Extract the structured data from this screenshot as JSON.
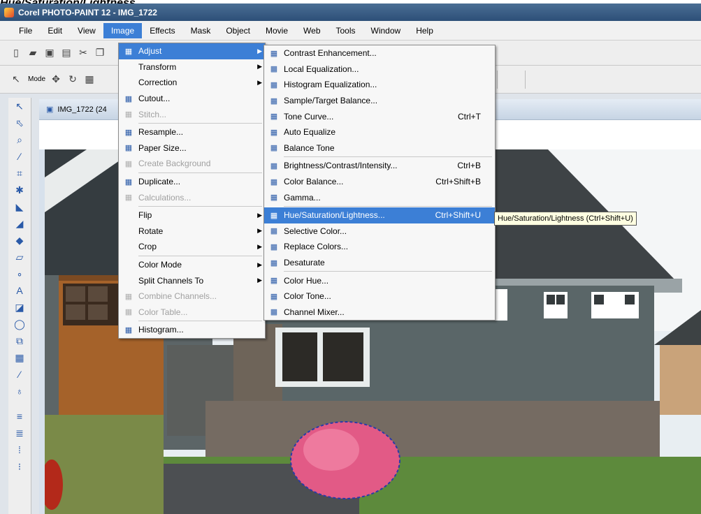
{
  "caption": "Hue/Saturation/Lightness",
  "titlebar": {
    "title": "Corel PHOTO-PAINT 12 - IMG_1722"
  },
  "menubar": {
    "items": [
      "File",
      "Edit",
      "View",
      "Image",
      "Effects",
      "Mask",
      "Object",
      "Movie",
      "Web",
      "Tools",
      "Window",
      "Help"
    ]
  },
  "toolbar2": {
    "mode_label": "Mode"
  },
  "document": {
    "title": "IMG_1722 (24"
  },
  "image_menu": {
    "items": [
      {
        "label": "Adjust",
        "icon": "adjust-icon",
        "submenu": true,
        "highlight": true
      },
      {
        "label": "Transform",
        "submenu": true
      },
      {
        "label": "Correction",
        "submenu": true
      },
      {
        "label": "Cutout...",
        "icon": "scissors-icon"
      },
      {
        "label": "Stitch...",
        "icon": "stitch-icon",
        "disabled": true
      },
      {
        "sep": true
      },
      {
        "label": "Resample...",
        "icon": "resample-icon"
      },
      {
        "label": "Paper Size...",
        "icon": "paper-size-icon"
      },
      {
        "label": "Create Background",
        "icon": "background-icon",
        "disabled": true
      },
      {
        "sep": true
      },
      {
        "label": "Duplicate...",
        "icon": "duplicate-icon"
      },
      {
        "label": "Calculations...",
        "icon": "calculations-icon",
        "disabled": true
      },
      {
        "sep": true
      },
      {
        "label": "Flip",
        "submenu": true
      },
      {
        "label": "Rotate",
        "submenu": true
      },
      {
        "label": "Crop",
        "submenu": true
      },
      {
        "sep": true
      },
      {
        "label": "Color Mode",
        "submenu": true
      },
      {
        "label": "Split Channels To",
        "submenu": true
      },
      {
        "label": "Combine Channels...",
        "icon": "combine-icon",
        "disabled": true
      },
      {
        "label": "Color Table...",
        "icon": "color-table-icon",
        "disabled": true
      },
      {
        "sep": true
      },
      {
        "label": "Histogram...",
        "icon": "histogram-icon"
      }
    ]
  },
  "adjust_menu": {
    "items": [
      {
        "label": "Contrast Enhancement...",
        "icon": "contrast-icon"
      },
      {
        "label": "Local Equalization...",
        "icon": "local-eq-icon"
      },
      {
        "label": "Histogram Equalization...",
        "icon": "histogram-eq-icon"
      },
      {
        "label": "Sample/Target Balance...",
        "icon": "sample-target-icon"
      },
      {
        "label": "Tone Curve...",
        "icon": "tone-curve-icon",
        "shortcut": "Ctrl+T"
      },
      {
        "label": "Auto Equalize",
        "icon": "auto-equalize-icon"
      },
      {
        "label": "Balance Tone",
        "icon": "balance-tone-icon"
      },
      {
        "sep": true
      },
      {
        "label": "Brightness/Contrast/Intensity...",
        "icon": "brightness-icon",
        "shortcut": "Ctrl+B"
      },
      {
        "label": "Color Balance...",
        "icon": "color-balance-icon",
        "shortcut": "Ctrl+Shift+B"
      },
      {
        "label": "Gamma...",
        "icon": "gamma-icon"
      },
      {
        "sep": true
      },
      {
        "label": "Hue/Saturation/Lightness...",
        "icon": "hue-saturation-icon",
        "shortcut": "Ctrl+Shift+U",
        "highlight": true
      },
      {
        "label": "Selective Color...",
        "icon": "selective-color-icon"
      },
      {
        "label": "Replace Colors...",
        "icon": "replace-colors-icon"
      },
      {
        "label": "Desaturate",
        "icon": "desaturate-icon"
      },
      {
        "sep": true
      },
      {
        "label": "Color Hue...",
        "icon": "color-hue-icon"
      },
      {
        "label": "Color Tone...",
        "icon": "color-tone-icon"
      },
      {
        "label": "Channel Mixer...",
        "icon": "channel-mixer-icon"
      }
    ]
  },
  "tooltip": {
    "text": "Hue/Saturation/Lightness (Ctrl+Shift+U)"
  },
  "colors": {
    "highlight": "#3c7fd6",
    "titlebar": "#34567e",
    "wall": "#5c6a6c",
    "roof": "#3d4244"
  }
}
